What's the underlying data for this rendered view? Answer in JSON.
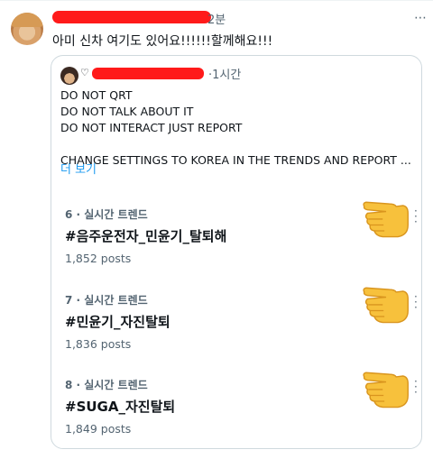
{
  "tweet": {
    "time": "2분",
    "text": "아미 신차 여기도 있어요!!!!!!할께해요!!!"
  },
  "quote": {
    "heart": "♡",
    "time": "·1시간",
    "lines": [
      "DO NOT QRT",
      "DO NOT TALK ABOUT IT",
      "DO NOT INTERACT JUST REPORT",
      "",
      "CHANGE SETTINGS TO KOREA IN THE TRENDS AND REPORT ..."
    ],
    "show_more": "더 보기"
  },
  "trends": [
    {
      "meta": "6 · 실시간 트렌드",
      "tag": "#음주운전자_민윤기_탈퇴해",
      "count": "1,852 posts"
    },
    {
      "meta": "7 · 실시간 트렌드",
      "tag": "#민윤기_자진탈퇴",
      "count": "1,836 posts"
    },
    {
      "meta": "8 · 실시간 트렌드",
      "tag": "#SUGA_자진탈퇴",
      "count": "1,849 posts"
    }
  ],
  "icons": {
    "pointing_hand": "backhand-index-pointing-left-emoji",
    "more": "more-dots-icon"
  },
  "colors": {
    "redaction": "#ff1a1a",
    "link": "#1d9bf0",
    "muted": "#536471",
    "hand": "#f7c13c"
  }
}
